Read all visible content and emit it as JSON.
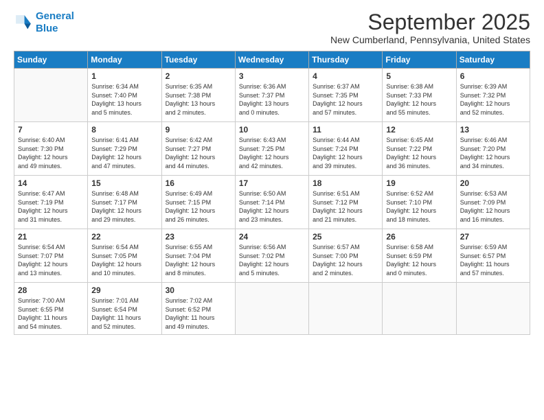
{
  "logo": {
    "line1": "General",
    "line2": "Blue"
  },
  "header": {
    "month": "September 2025",
    "location": "New Cumberland, Pennsylvania, United States"
  },
  "weekdays": [
    "Sunday",
    "Monday",
    "Tuesday",
    "Wednesday",
    "Thursday",
    "Friday",
    "Saturday"
  ],
  "weeks": [
    [
      {
        "day": "",
        "info": ""
      },
      {
        "day": "1",
        "info": "Sunrise: 6:34 AM\nSunset: 7:40 PM\nDaylight: 13 hours\nand 5 minutes."
      },
      {
        "day": "2",
        "info": "Sunrise: 6:35 AM\nSunset: 7:38 PM\nDaylight: 13 hours\nand 2 minutes."
      },
      {
        "day": "3",
        "info": "Sunrise: 6:36 AM\nSunset: 7:37 PM\nDaylight: 13 hours\nand 0 minutes."
      },
      {
        "day": "4",
        "info": "Sunrise: 6:37 AM\nSunset: 7:35 PM\nDaylight: 12 hours\nand 57 minutes."
      },
      {
        "day": "5",
        "info": "Sunrise: 6:38 AM\nSunset: 7:33 PM\nDaylight: 12 hours\nand 55 minutes."
      },
      {
        "day": "6",
        "info": "Sunrise: 6:39 AM\nSunset: 7:32 PM\nDaylight: 12 hours\nand 52 minutes."
      }
    ],
    [
      {
        "day": "7",
        "info": "Sunrise: 6:40 AM\nSunset: 7:30 PM\nDaylight: 12 hours\nand 49 minutes."
      },
      {
        "day": "8",
        "info": "Sunrise: 6:41 AM\nSunset: 7:29 PM\nDaylight: 12 hours\nand 47 minutes."
      },
      {
        "day": "9",
        "info": "Sunrise: 6:42 AM\nSunset: 7:27 PM\nDaylight: 12 hours\nand 44 minutes."
      },
      {
        "day": "10",
        "info": "Sunrise: 6:43 AM\nSunset: 7:25 PM\nDaylight: 12 hours\nand 42 minutes."
      },
      {
        "day": "11",
        "info": "Sunrise: 6:44 AM\nSunset: 7:24 PM\nDaylight: 12 hours\nand 39 minutes."
      },
      {
        "day": "12",
        "info": "Sunrise: 6:45 AM\nSunset: 7:22 PM\nDaylight: 12 hours\nand 36 minutes."
      },
      {
        "day": "13",
        "info": "Sunrise: 6:46 AM\nSunset: 7:20 PM\nDaylight: 12 hours\nand 34 minutes."
      }
    ],
    [
      {
        "day": "14",
        "info": "Sunrise: 6:47 AM\nSunset: 7:19 PM\nDaylight: 12 hours\nand 31 minutes."
      },
      {
        "day": "15",
        "info": "Sunrise: 6:48 AM\nSunset: 7:17 PM\nDaylight: 12 hours\nand 29 minutes."
      },
      {
        "day": "16",
        "info": "Sunrise: 6:49 AM\nSunset: 7:15 PM\nDaylight: 12 hours\nand 26 minutes."
      },
      {
        "day": "17",
        "info": "Sunrise: 6:50 AM\nSunset: 7:14 PM\nDaylight: 12 hours\nand 23 minutes."
      },
      {
        "day": "18",
        "info": "Sunrise: 6:51 AM\nSunset: 7:12 PM\nDaylight: 12 hours\nand 21 minutes."
      },
      {
        "day": "19",
        "info": "Sunrise: 6:52 AM\nSunset: 7:10 PM\nDaylight: 12 hours\nand 18 minutes."
      },
      {
        "day": "20",
        "info": "Sunrise: 6:53 AM\nSunset: 7:09 PM\nDaylight: 12 hours\nand 16 minutes."
      }
    ],
    [
      {
        "day": "21",
        "info": "Sunrise: 6:54 AM\nSunset: 7:07 PM\nDaylight: 12 hours\nand 13 minutes."
      },
      {
        "day": "22",
        "info": "Sunrise: 6:54 AM\nSunset: 7:05 PM\nDaylight: 12 hours\nand 10 minutes."
      },
      {
        "day": "23",
        "info": "Sunrise: 6:55 AM\nSunset: 7:04 PM\nDaylight: 12 hours\nand 8 minutes."
      },
      {
        "day": "24",
        "info": "Sunrise: 6:56 AM\nSunset: 7:02 PM\nDaylight: 12 hours\nand 5 minutes."
      },
      {
        "day": "25",
        "info": "Sunrise: 6:57 AM\nSunset: 7:00 PM\nDaylight: 12 hours\nand 2 minutes."
      },
      {
        "day": "26",
        "info": "Sunrise: 6:58 AM\nSunset: 6:59 PM\nDaylight: 12 hours\nand 0 minutes."
      },
      {
        "day": "27",
        "info": "Sunrise: 6:59 AM\nSunset: 6:57 PM\nDaylight: 11 hours\nand 57 minutes."
      }
    ],
    [
      {
        "day": "28",
        "info": "Sunrise: 7:00 AM\nSunset: 6:55 PM\nDaylight: 11 hours\nand 54 minutes."
      },
      {
        "day": "29",
        "info": "Sunrise: 7:01 AM\nSunset: 6:54 PM\nDaylight: 11 hours\nand 52 minutes."
      },
      {
        "day": "30",
        "info": "Sunrise: 7:02 AM\nSunset: 6:52 PM\nDaylight: 11 hours\nand 49 minutes."
      },
      {
        "day": "",
        "info": ""
      },
      {
        "day": "",
        "info": ""
      },
      {
        "day": "",
        "info": ""
      },
      {
        "day": "",
        "info": ""
      }
    ]
  ]
}
